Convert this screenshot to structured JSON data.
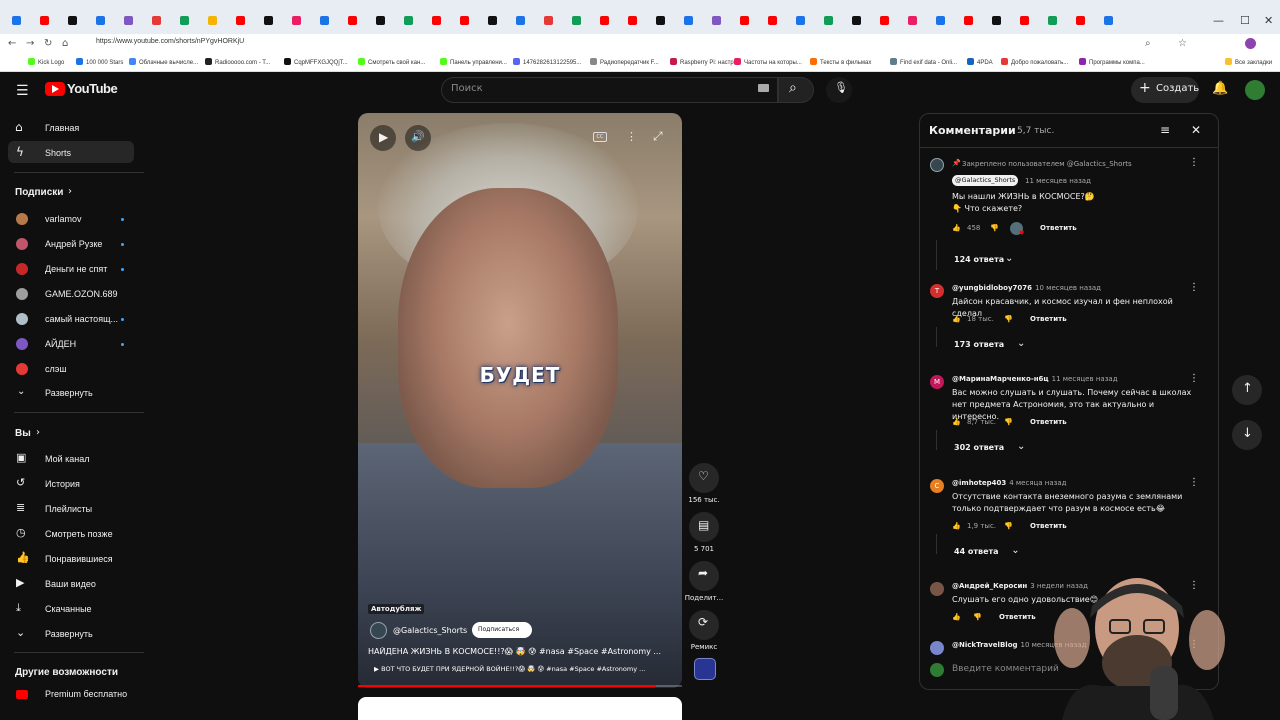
{
  "browser": {
    "url": "https://www.youtube.com/shorts/nPYgvHORKjU",
    "bookmarks": [
      {
        "label": "Kick Logo",
        "color": "#53fc18"
      },
      {
        "label": "100 000 Stars",
        "color": "#1a73e8"
      },
      {
        "label": "Облачные вычисле...",
        "color": "#4285f4"
      },
      {
        "label": "Radiooooo.com - T...",
        "color": "#222222"
      },
      {
        "label": "CqpMFFXGJQQjT...",
        "color": "#111111"
      },
      {
        "label": "Смотреть свой кан...",
        "color": "#53fc18"
      },
      {
        "label": "Панель управлени...",
        "color": "#53fc18"
      },
      {
        "label": "1476282613122595...",
        "color": "#5865f2"
      },
      {
        "label": "Радиопередатчик F...",
        "color": "#888888"
      },
      {
        "label": "Raspberry Pi: настр...",
        "color": "#c51a4a"
      },
      {
        "label": "Частоты на которы...",
        "color": "#e91e63"
      },
      {
        "label": "Тексты в фильмах",
        "color": "#ff6d00"
      },
      {
        "label": "Find exif data - Onli...",
        "color": "#607d8b"
      },
      {
        "label": "4PDA",
        "color": "#1565c0"
      },
      {
        "label": "Добро пожаловать...",
        "color": "#e53935"
      },
      {
        "label": "Программы компа...",
        "color": "#8e24aa"
      },
      {
        "label": "Все закладки",
        "color": "#fbc02d"
      }
    ]
  },
  "header": {
    "logo_text": "YouTube",
    "search_placeholder": "Поиск",
    "create_label": "Создать"
  },
  "sidebar": {
    "main": [
      {
        "label": "Главная",
        "icon": "home-icon"
      },
      {
        "label": "Shorts",
        "icon": "shorts-icon"
      }
    ],
    "subs_title": "Подписки",
    "subs": [
      {
        "label": "varlamov",
        "color": "#b57a4a",
        "dot": true
      },
      {
        "label": "Андрей Рузке",
        "color": "#c0566a",
        "dot": true
      },
      {
        "label": "Деньги не спят",
        "color": "#c62828",
        "dot": true
      },
      {
        "label": "GAME.OZON.689",
        "color": "#9e9e9e",
        "dot": false
      },
      {
        "label": "самый настоящ...",
        "color": "#b0bec5",
        "dot": true
      },
      {
        "label": "АЙДЕН",
        "color": "#7e57c2",
        "dot": true
      },
      {
        "label": "слэш",
        "color": "#e53935",
        "dot": false
      }
    ],
    "subs_expand": "Развернуть",
    "you_title": "Вы",
    "you": [
      {
        "label": "Мой канал",
        "icon": "account-icon"
      },
      {
        "label": "История",
        "icon": "history-icon"
      },
      {
        "label": "Плейлисты",
        "icon": "playlists-icon"
      },
      {
        "label": "Смотреть позже",
        "icon": "watch-later-icon"
      },
      {
        "label": "Понравившиеся",
        "icon": "like-icon"
      },
      {
        "label": "Ваши видео",
        "icon": "your-videos-icon"
      },
      {
        "label": "Скачанные",
        "icon": "download-icon"
      },
      {
        "label": "Развернуть",
        "icon": "chevron-down-icon"
      }
    ],
    "more_title": "Другие возможности",
    "premium_label": "Premium бесплатно"
  },
  "video": {
    "caption": "БУДЕТ",
    "auto_label": "Автодубляж",
    "channel": "@Galactics_Shorts",
    "subscribe_label": "Подписаться",
    "title": "НАЙДЕНА ЖИЗНЬ В КОСМОСЕ!!?😱 🤯 😰 #nasa #Space #Astronomy ...",
    "related": "▶ ВОТ ЧТО БУДЕТ ПРИ ЯДЕРНОЙ ВОЙНЕ!!?😱 🤯 😰 #nasa #Space #Astronomy ...",
    "progress": 0.92
  },
  "actions": {
    "likes": "156 тыс.",
    "comments": "5 701",
    "share": "Поделит...",
    "remix": "Ремикс"
  },
  "comments": {
    "title": "Комментарии",
    "count": "5,7 тыс.",
    "input_placeholder": "Введите комментарий",
    "reply_label": "Ответить",
    "pinned": {
      "pin_text": "Закреплено пользователем @Galactics_Shorts",
      "author": "@Galactics_Shorts",
      "time": "11 месяцев назад",
      "line1": "Мы нашли ЖИЗНЬ в КОСМОСЕ?🤔",
      "line2": "👇 Что скажете?",
      "likes": "458",
      "replies": "124 ответа"
    },
    "items": [
      {
        "author": "@yungbidloboy7076",
        "time": "10 месяцев назад",
        "text": "Дайсон красавчик, и космос изучал и фен неплохой сделал",
        "likes": "18 тыс.",
        "replies": "173 ответа",
        "avatar": "T",
        "color": "#d32f2f"
      },
      {
        "author": "@МаринаМарченко-н6ц",
        "time": "11 месяцев назад",
        "text": "Вас можно слушать и слушать. Почему сейчас в школах нет предмета Астрономия, это так актуально и интересно.",
        "likes": "8,7 тыс.",
        "replies": "302 ответа",
        "avatar": "M",
        "color": "#c2185b"
      },
      {
        "author": "@imhotep403",
        "time": "4 месяца назад",
        "text": "Отсутствие контакта внеземного разума с землянами только подтверждает что разум в космосе есть😂",
        "likes": "1,9 тыс.",
        "replies": "44 ответа",
        "avatar": "C",
        "color": "#e67e22"
      },
      {
        "author": "@Андрей_Керосин",
        "time": "3 недели назад",
        "text": "Слушать его одно удовольствие😊",
        "likes": "",
        "replies": "",
        "avatar": "",
        "color": "#795548"
      },
      {
        "author": "@NickTravelBlog",
        "time": "10 месяцев назад",
        "text": "",
        "likes": "",
        "replies": "",
        "avatar": "",
        "color": "#7986cb"
      }
    ]
  }
}
